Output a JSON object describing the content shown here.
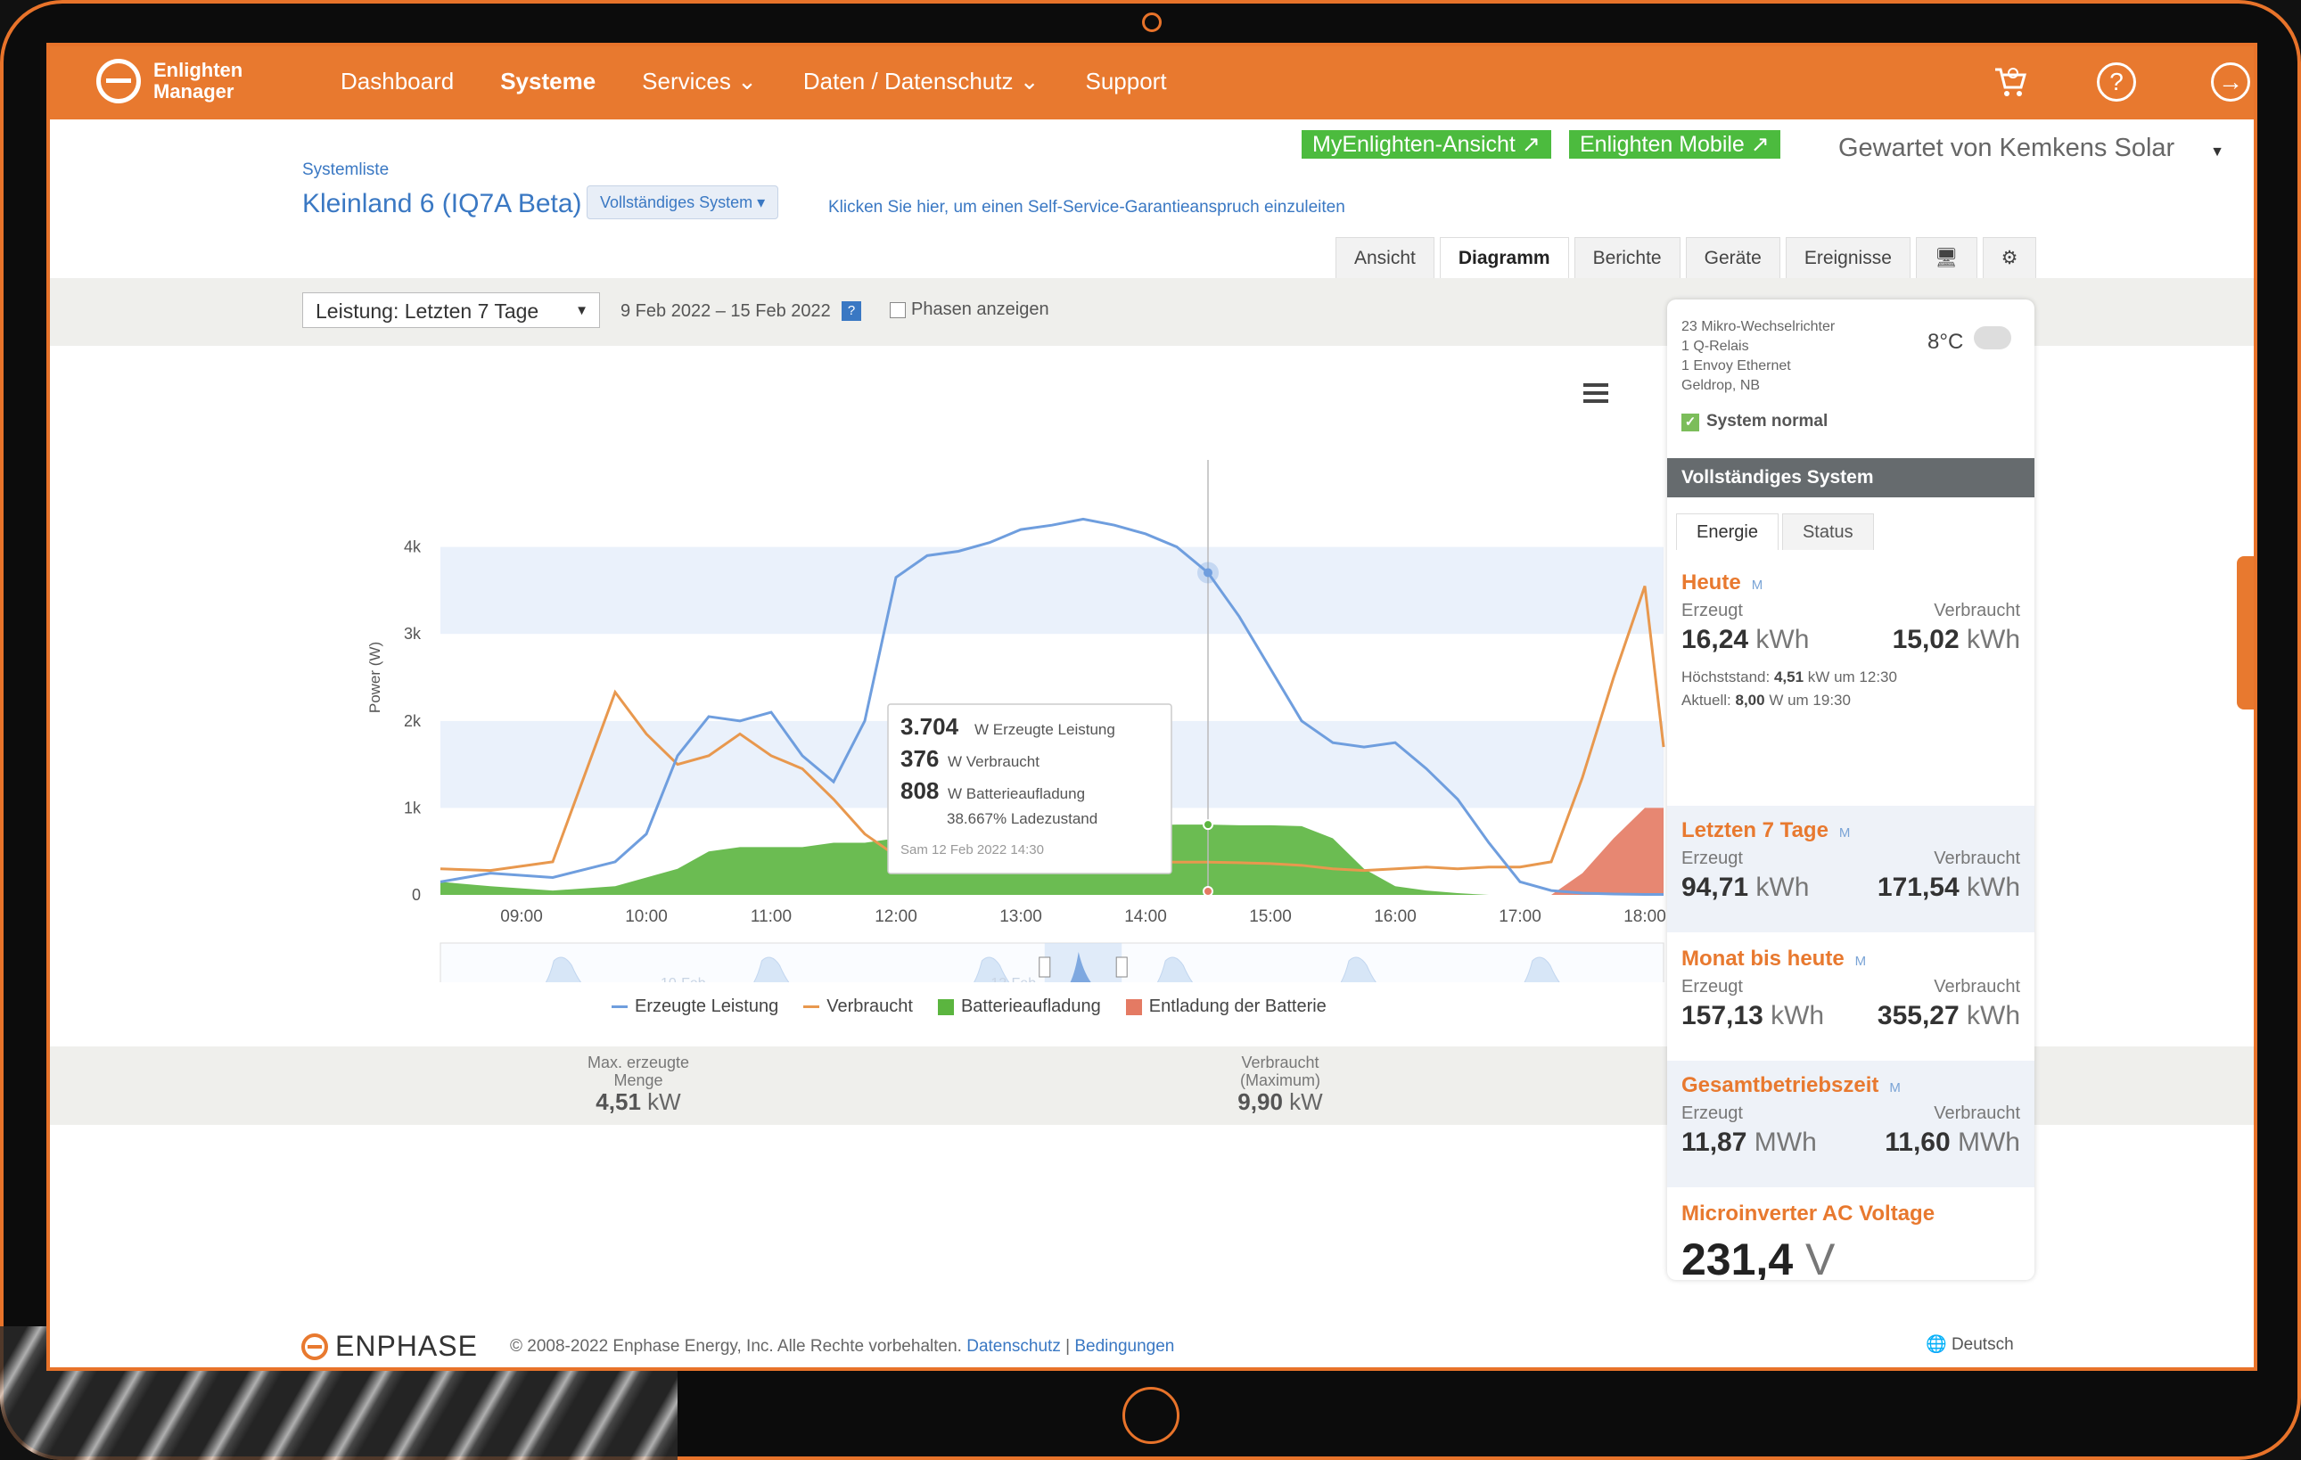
{
  "nav": {
    "brand_line1": "Enlighten",
    "brand_line2": "Manager",
    "items": [
      "Dashboard",
      "Systeme",
      "Services ⌄",
      "Daten / Datenschutz ⌄",
      "Support"
    ]
  },
  "top_buttons": {
    "myenlighten": "MyEnlighten-Ansicht",
    "mobile": "Enlighten Mobile",
    "maintained_by": "Gewartet von Kemkens Solar"
  },
  "system": {
    "breadcrumb": "Systemliste",
    "name": "Kleinland 6 (IQ7A Beta)",
    "scope_button": "Vollständiges System ▾",
    "claim_link": "Klicken Sie hier, um einen Self-Service-Garantieanspruch einzuleiten"
  },
  "tabs": [
    "Ansicht",
    "Diagramm",
    "Berichte",
    "Geräte",
    "Ereignisse"
  ],
  "filter": {
    "select_value": "Leistung: Letzten 7 Tage",
    "date_range": "9 Feb 2022 – 15 Feb 2022",
    "help": "?",
    "phases_label": "Phasen anzeigen"
  },
  "chart_data": {
    "type": "line",
    "ylabel": "Power (W)",
    "ylim": [
      0,
      5000
    ],
    "y_ticks": [
      "0",
      "1k",
      "2k",
      "3k",
      "4k"
    ],
    "x_ticks": [
      "09:00",
      "10:00",
      "11:00",
      "12:00",
      "13:00",
      "14:00",
      "15:00",
      "16:00",
      "17:00",
      "18:00"
    ],
    "x": [
      8.35,
      8.75,
      9.25,
      9.75,
      10.0,
      10.25,
      10.5,
      10.75,
      11.0,
      11.25,
      11.5,
      11.75,
      12.0,
      12.25,
      12.5,
      12.75,
      13.0,
      13.25,
      13.5,
      13.75,
      14.0,
      14.25,
      14.5,
      14.75,
      15.0,
      15.25,
      15.5,
      15.75,
      16.0,
      16.25,
      16.5,
      16.75,
      17.0,
      17.25,
      17.5,
      17.75,
      18.0,
      18.15
    ],
    "series": [
      {
        "name": "Erzeugte Leistung",
        "color": "#6f9ede",
        "values": [
          150,
          250,
          200,
          380,
          700,
          1600,
          2050,
          2000,
          2100,
          1600,
          1300,
          2000,
          3650,
          3900,
          3950,
          4050,
          4200,
          4250,
          4320,
          4250,
          4150,
          4000,
          3704,
          3200,
          2600,
          2000,
          1750,
          1700,
          1750,
          1450,
          1100,
          600,
          150,
          50,
          20,
          10,
          5,
          5
        ]
      },
      {
        "name": "Verbraucht",
        "color": "#e8984e",
        "values": [
          300,
          280,
          380,
          2330,
          1850,
          1500,
          1600,
          1850,
          1600,
          1450,
          1100,
          700,
          450,
          400,
          1000,
          700,
          420,
          400,
          390,
          380,
          380,
          376,
          376,
          370,
          360,
          340,
          300,
          280,
          300,
          320,
          300,
          320,
          320,
          380,
          1350,
          2500,
          3550,
          1700
        ]
      },
      {
        "name": "Batterieaufladung",
        "color": "#5bb53f",
        "values": [
          150,
          100,
          50,
          100,
          200,
          300,
          500,
          550,
          550,
          550,
          600,
          600,
          650,
          700,
          700,
          720,
          730,
          750,
          770,
          790,
          800,
          808,
          808,
          800,
          800,
          790,
          650,
          300,
          100,
          50,
          20,
          0,
          0,
          0,
          0,
          0,
          0,
          0
        ]
      },
      {
        "name": "Entladung der Batterie",
        "color": "#e47a63",
        "values": [
          0,
          0,
          0,
          0,
          0,
          0,
          0,
          0,
          0,
          0,
          0,
          0,
          0,
          0,
          0,
          0,
          0,
          0,
          0,
          0,
          0,
          0,
          0,
          0,
          0,
          0,
          0,
          0,
          0,
          0,
          0,
          0,
          0,
          0,
          250,
          650,
          1000,
          1000
        ]
      }
    ],
    "legend": [
      "Erzeugte Leistung",
      "Verbraucht",
      "Batterieaufladung",
      "Entladung der Batterie"
    ],
    "navigator_labels": [
      "10-Feb",
      "12-Feb"
    ],
    "tooltip": {
      "gen_value": "3.704",
      "gen_label": "W Erzeugte Leistung",
      "cons_value": "376",
      "cons_label": "W Verbraucht",
      "bat_value": "808",
      "bat_label": "W Batterieaufladung",
      "soc": "38.667% Ladezustand",
      "time": "Sam 12 Feb 2022 14:30"
    }
  },
  "stats": {
    "max_gen_label1": "Max. erzeugte",
    "max_gen_label2": "Menge",
    "max_gen_value": "4,51",
    "max_gen_unit": "kW",
    "cons_label1": "Verbraucht",
    "cons_label2": "(Maximum)",
    "cons_value": "9,90",
    "cons_unit": "kW"
  },
  "panel": {
    "info": [
      "23 Mikro-Wechselrichter",
      "1 Q-Relais",
      "1 Envoy   Ethernet",
      "Geldrop, NB"
    ],
    "temp": "8°C",
    "status": "System normal",
    "header": "Vollständiges System",
    "tabs": [
      "Energie",
      "Status"
    ],
    "produced": "Erzeugt",
    "consumed": "Verbraucht",
    "today": {
      "title": "Heute",
      "gen": "16,24",
      "gen_unit": "kWh",
      "cons": "15,02",
      "cons_unit": "kWh",
      "peak_label": "Höchststand:",
      "peak_value": "4,51",
      "peak_rest": "kW um 12:30",
      "now_label": "Aktuell:",
      "now_value": "8,00",
      "now_rest": "W um 19:30"
    },
    "last7": {
      "title": "Letzten 7 Tage",
      "gen": "94,71",
      "gen_unit": "kWh",
      "cons": "171,54",
      "cons_unit": "kWh"
    },
    "month": {
      "title": "Monat bis heute",
      "gen": "157,13",
      "gen_unit": "kWh",
      "cons": "355,27",
      "cons_unit": "kWh"
    },
    "lifetime": {
      "title": "Gesamtbetriebszeit",
      "gen": "11,87",
      "gen_unit": "MWh",
      "cons": "11,60",
      "cons_unit": "MWh"
    },
    "voltage": {
      "title": "Microinverter AC Voltage",
      "value": "231,4",
      "unit": "V"
    },
    "m_marker": "M"
  },
  "footer": {
    "brand": "ENPHASE",
    "copyright": "© 2008-2022 Enphase Energy, Inc. Alle Rechte vorbehalten.",
    "privacy": "Datenschutz",
    "sep": "|",
    "terms": "Bedingungen",
    "language": "Deutsch"
  }
}
